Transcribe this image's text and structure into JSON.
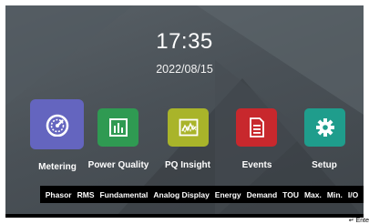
{
  "clock": {
    "time": "17:35",
    "date": "2022/08/15"
  },
  "tiles": [
    {
      "id": "metering",
      "label": "Metering",
      "icon": "gauge-icon",
      "color": "#6465bf"
    },
    {
      "id": "power-quality",
      "label": "Power Quality",
      "icon": "bar-chart-icon",
      "color": "#2f9a52"
    },
    {
      "id": "pq-insight",
      "label": "PQ Insight",
      "icon": "waveform-icon",
      "color": "#a9b42a"
    },
    {
      "id": "events",
      "label": "Events",
      "icon": "document-icon",
      "color": "#c8282d"
    },
    {
      "id": "setup",
      "label": "Setup",
      "icon": "gear-icon",
      "color": "#1f9d8c"
    }
  ],
  "submenu": [
    "Phasor",
    "RMS",
    "Fundamental",
    "Analog Display",
    "Energy",
    "Demand",
    "TOU",
    "Max.",
    "Min.",
    "I/O"
  ],
  "footer": {
    "enter_hint": "↵ Ente"
  }
}
